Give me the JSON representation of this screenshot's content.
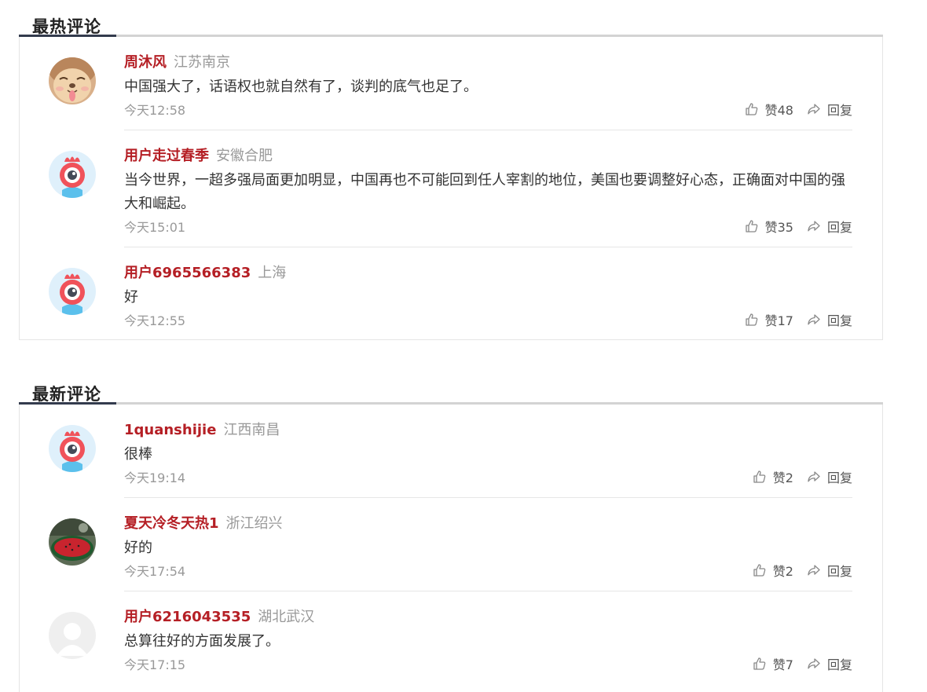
{
  "hot": {
    "title": "最热评论",
    "comments": [
      {
        "user": "周沐风",
        "location": "江苏南京",
        "text": "中国强大了，话语权也就自然有了，谈判的底气也足了。",
        "time": "今天12:58",
        "likes": "赞48",
        "reply": "回复",
        "avatar": "dog-avatar"
      },
      {
        "user": "用户走过春季",
        "location": "安徽合肥",
        "text": "当今世界，一超多强局面更加明显，中国再也不可能回到任人宰割的地位，美国也要调整好心态，正确面对中国的强大和崛起。",
        "time": "今天15:01",
        "likes": "赞35",
        "reply": "回复",
        "avatar": "weibo-eye-avatar"
      },
      {
        "user": "用户6965566383",
        "location": "上海",
        "text": "好",
        "time": "今天12:55",
        "likes": "赞17",
        "reply": "回复",
        "avatar": "weibo-eye-avatar"
      }
    ]
  },
  "latest": {
    "title": "最新评论",
    "comments": [
      {
        "user": "1quanshijie",
        "location": "江西南昌",
        "text": "很棒",
        "time": "今天19:14",
        "likes": "赞2",
        "reply": "回复",
        "avatar": "weibo-eye-avatar"
      },
      {
        "user": "夏天冷冬天热1",
        "location": "浙江绍兴",
        "text": "好的",
        "time": "今天17:54",
        "likes": "赞2",
        "reply": "回复",
        "avatar": "watermelon-avatar"
      },
      {
        "user": "用户6216043535",
        "location": "湖北武汉",
        "text": "总算往好的方面发展了。",
        "time": "今天17:15",
        "likes": "赞7",
        "reply": "回复",
        "avatar": "default-avatar"
      }
    ]
  },
  "colors": {
    "username": "#b51f25",
    "muted": "#999999",
    "title_underline": "#333b4d"
  }
}
